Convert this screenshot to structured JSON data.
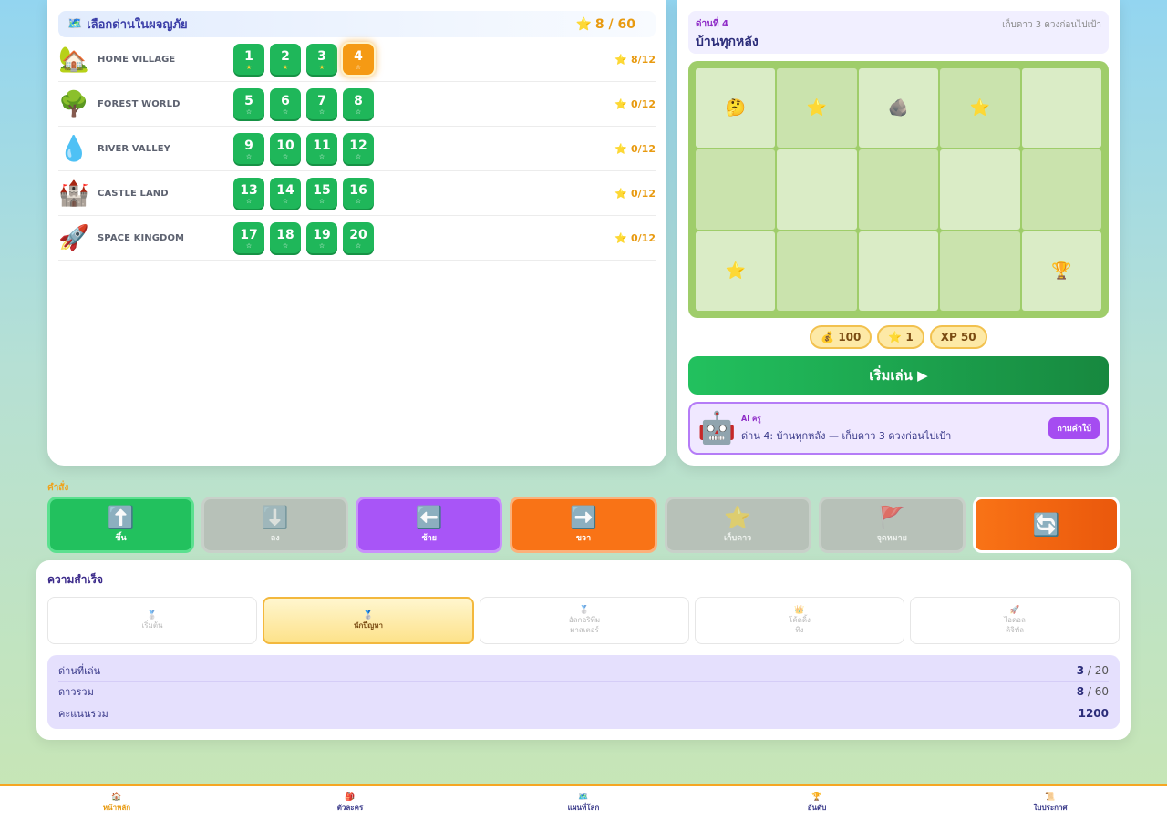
{
  "level_select": {
    "title": "เลือกด่านในผจญภัย",
    "title_icon": "map-icon",
    "stars_total": "8 / 60",
    "worlds": [
      {
        "name": "HOME VILLAGE",
        "icon": "🏡",
        "score": "8/12",
        "levels": [
          {
            "num": "1",
            "earned": true,
            "current": false
          },
          {
            "num": "2",
            "earned": true,
            "current": false
          },
          {
            "num": "3",
            "earned": true,
            "current": false
          },
          {
            "num": "4",
            "earned": false,
            "current": true
          }
        ]
      },
      {
        "name": "FOREST WORLD",
        "icon": "🌳",
        "score": "0/12",
        "levels": [
          {
            "num": "5",
            "earned": false,
            "current": false
          },
          {
            "num": "6",
            "earned": false,
            "current": false
          },
          {
            "num": "7",
            "earned": false,
            "current": false
          },
          {
            "num": "8",
            "earned": false,
            "current": false
          }
        ]
      },
      {
        "name": "RIVER VALLEY",
        "icon": "💧",
        "score": "0/12",
        "levels": [
          {
            "num": "9",
            "earned": false,
            "current": false
          },
          {
            "num": "10",
            "earned": false,
            "current": false
          },
          {
            "num": "11",
            "earned": false,
            "current": false
          },
          {
            "num": "12",
            "earned": false,
            "current": false
          }
        ]
      },
      {
        "name": "CASTLE LAND",
        "icon": "🏰",
        "score": "0/12",
        "levels": [
          {
            "num": "13",
            "earned": false,
            "current": false
          },
          {
            "num": "14",
            "earned": false,
            "current": false
          },
          {
            "num": "15",
            "earned": false,
            "current": false
          },
          {
            "num": "16",
            "earned": false,
            "current": false
          }
        ]
      },
      {
        "name": "SPACE KINGDOM",
        "icon": "🚀",
        "score": "0/12",
        "levels": [
          {
            "num": "17",
            "earned": false,
            "current": false
          },
          {
            "num": "18",
            "earned": false,
            "current": false
          },
          {
            "num": "19",
            "earned": false,
            "current": false
          },
          {
            "num": "20",
            "earned": false,
            "current": false
          }
        ]
      }
    ]
  },
  "level_detail": {
    "subtitle": "ด่านที่ 4",
    "title": "บ้านทุกหลัง",
    "goal": "เก็บดาว 3 ดวงก่อนไปเป้า",
    "board": [
      [
        "🤔",
        "⭐",
        "🪨",
        "⭐",
        ""
      ],
      [
        "",
        "",
        "",
        "",
        ""
      ],
      [
        "⭐",
        "",
        "",
        "",
        "🏆"
      ]
    ],
    "rewards": [
      {
        "icon": "💰",
        "text": "100"
      },
      {
        "icon": "⭐",
        "text": "1"
      },
      {
        "icon": "",
        "text": "XP 50"
      }
    ],
    "play_label": "เริ่มเล่น ▶",
    "ai": {
      "label": "AI ครู",
      "message": "ด่าน 4: บ้านทุกหลัง — เก็บดาว 3 ดวงก่อนไปเป้า",
      "ask_label": "ถามคำใบ้"
    }
  },
  "commands": {
    "label": "คำสั่ง",
    "buttons": [
      {
        "icon": "⬆️",
        "label": "ขึ้น",
        "style": "green",
        "name": "up"
      },
      {
        "icon": "⬇️",
        "label": "ลง",
        "style": "disabled",
        "name": "down"
      },
      {
        "icon": "⬅️",
        "label": "ซ้าย",
        "style": "purple",
        "name": "left"
      },
      {
        "icon": "➡️",
        "label": "ขวา",
        "style": "orange",
        "name": "right"
      },
      {
        "icon": "⭐",
        "label": "เก็บดาว",
        "style": "disabled",
        "name": "collect-star"
      },
      {
        "icon": "🚩",
        "label": "จุดหมาย",
        "style": "disabled",
        "name": "goal"
      },
      {
        "icon": "🔄",
        "label": "",
        "style": "reset",
        "name": "reset"
      }
    ]
  },
  "achievements": {
    "title": "ความสำเร็จ",
    "badges": [
      {
        "icon": "🥈",
        "lines": [
          "เริ่มต้น"
        ],
        "active": false
      },
      {
        "icon": "🥈",
        "lines": [
          "นักปีญหา"
        ],
        "active": true
      },
      {
        "icon": "🥈",
        "lines": [
          "อัลกอริทึม",
          "มาสเตอร์"
        ],
        "active": false
      },
      {
        "icon": "👑",
        "lines": [
          "โค้ดดิ้ง",
          "ทิง"
        ],
        "active": false
      },
      {
        "icon": "🚀",
        "lines": [
          "ไอดอล",
          "ดิจิทัล"
        ],
        "active": false
      }
    ],
    "stats": [
      {
        "label": "ด่านที่เล่น",
        "value": "3",
        "total": " / 20"
      },
      {
        "label": "ดาวรวม",
        "value": "8",
        "total": " / 60"
      },
      {
        "label": "คะแนนรวม",
        "value": "1200",
        "total": ""
      }
    ]
  },
  "bottom_nav": [
    {
      "icon": "🏠",
      "label": "หน้าหลัก",
      "active": true
    },
    {
      "icon": "🎒",
      "label": "ตัวละคร",
      "active": false
    },
    {
      "icon": "🗺️",
      "label": "แผนที่โลก",
      "active": false
    },
    {
      "icon": "🏆",
      "label": "อันดับ",
      "active": false
    },
    {
      "icon": "📜",
      "label": "ใบประกาศ",
      "active": false
    }
  ],
  "colors": {
    "accent_green": "#1fb75a",
    "accent_orange": "#f59a14",
    "accent_purple": "#a855f7",
    "star_gold": "#e89a10"
  }
}
